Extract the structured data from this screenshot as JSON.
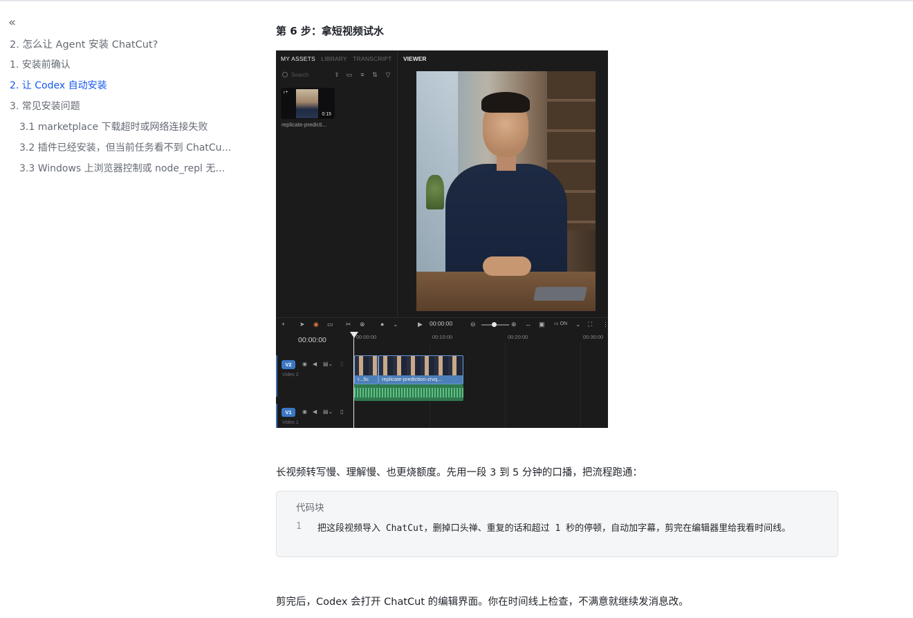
{
  "toc": {
    "collapse_icon": "«",
    "items": [
      {
        "label": "2. 怎么让 Agent 安装 ChatCut?"
      },
      {
        "label": "1. 安装前确认"
      },
      {
        "label": "2. 让 Codex 自动安装"
      },
      {
        "label": "3. 常见安装问题"
      },
      {
        "label": "3.1 marketplace 下载超时或网络连接失败"
      },
      {
        "label": "3.2 插件已经安装，但当前任务看不到 ChatCut ..."
      },
      {
        "label": "3.3 Windows 上浏览器控制或 node_repl 无法..."
      }
    ],
    "active_index": 2,
    "accent_color": "#1456f0"
  },
  "main": {
    "step_title": "第 6 步：拿短视频试水",
    "editor": {
      "tabs": [
        "MY ASSETS",
        "LIBRARY",
        "TRANSCRIPT"
      ],
      "search_placeholder": "Search",
      "asset": {
        "duration": "0:15",
        "name": "replicate-predicti...",
        "audio_icon": "♪+"
      },
      "viewer_label": "VIEWER",
      "toolbar": {
        "play_time": "00:00:00",
        "cc_label": "ON"
      },
      "timecode": "00:00:00",
      "ruler_ticks": [
        "00:00:00",
        "00:10:00",
        "00:20:00",
        "00:30:00"
      ],
      "tracks": [
        {
          "badge": "V2",
          "name": "Video 2"
        },
        {
          "badge": "V1",
          "name": "Video 1"
        }
      ],
      "clips": [
        {
          "label": "r...5c"
        },
        {
          "label": "replicate-prediction-zrvq..."
        }
      ]
    },
    "para1": "长视频转写慢、理解慢、也更烧额度。先用一段 3 到 5 分钟的口播，把流程跑通：",
    "code": {
      "title": "代码块",
      "line_number": "1",
      "line": "把这段视频导入 ChatCut，删掉口头禅、重复的话和超过 1 秒的停顿，自动加字幕，剪完在编辑器里给我看时间线。"
    },
    "para2": "剪完后，Codex 会打开 ChatCut 的编辑界面。你在时间线上检查，不满意就继续发消息改。"
  }
}
